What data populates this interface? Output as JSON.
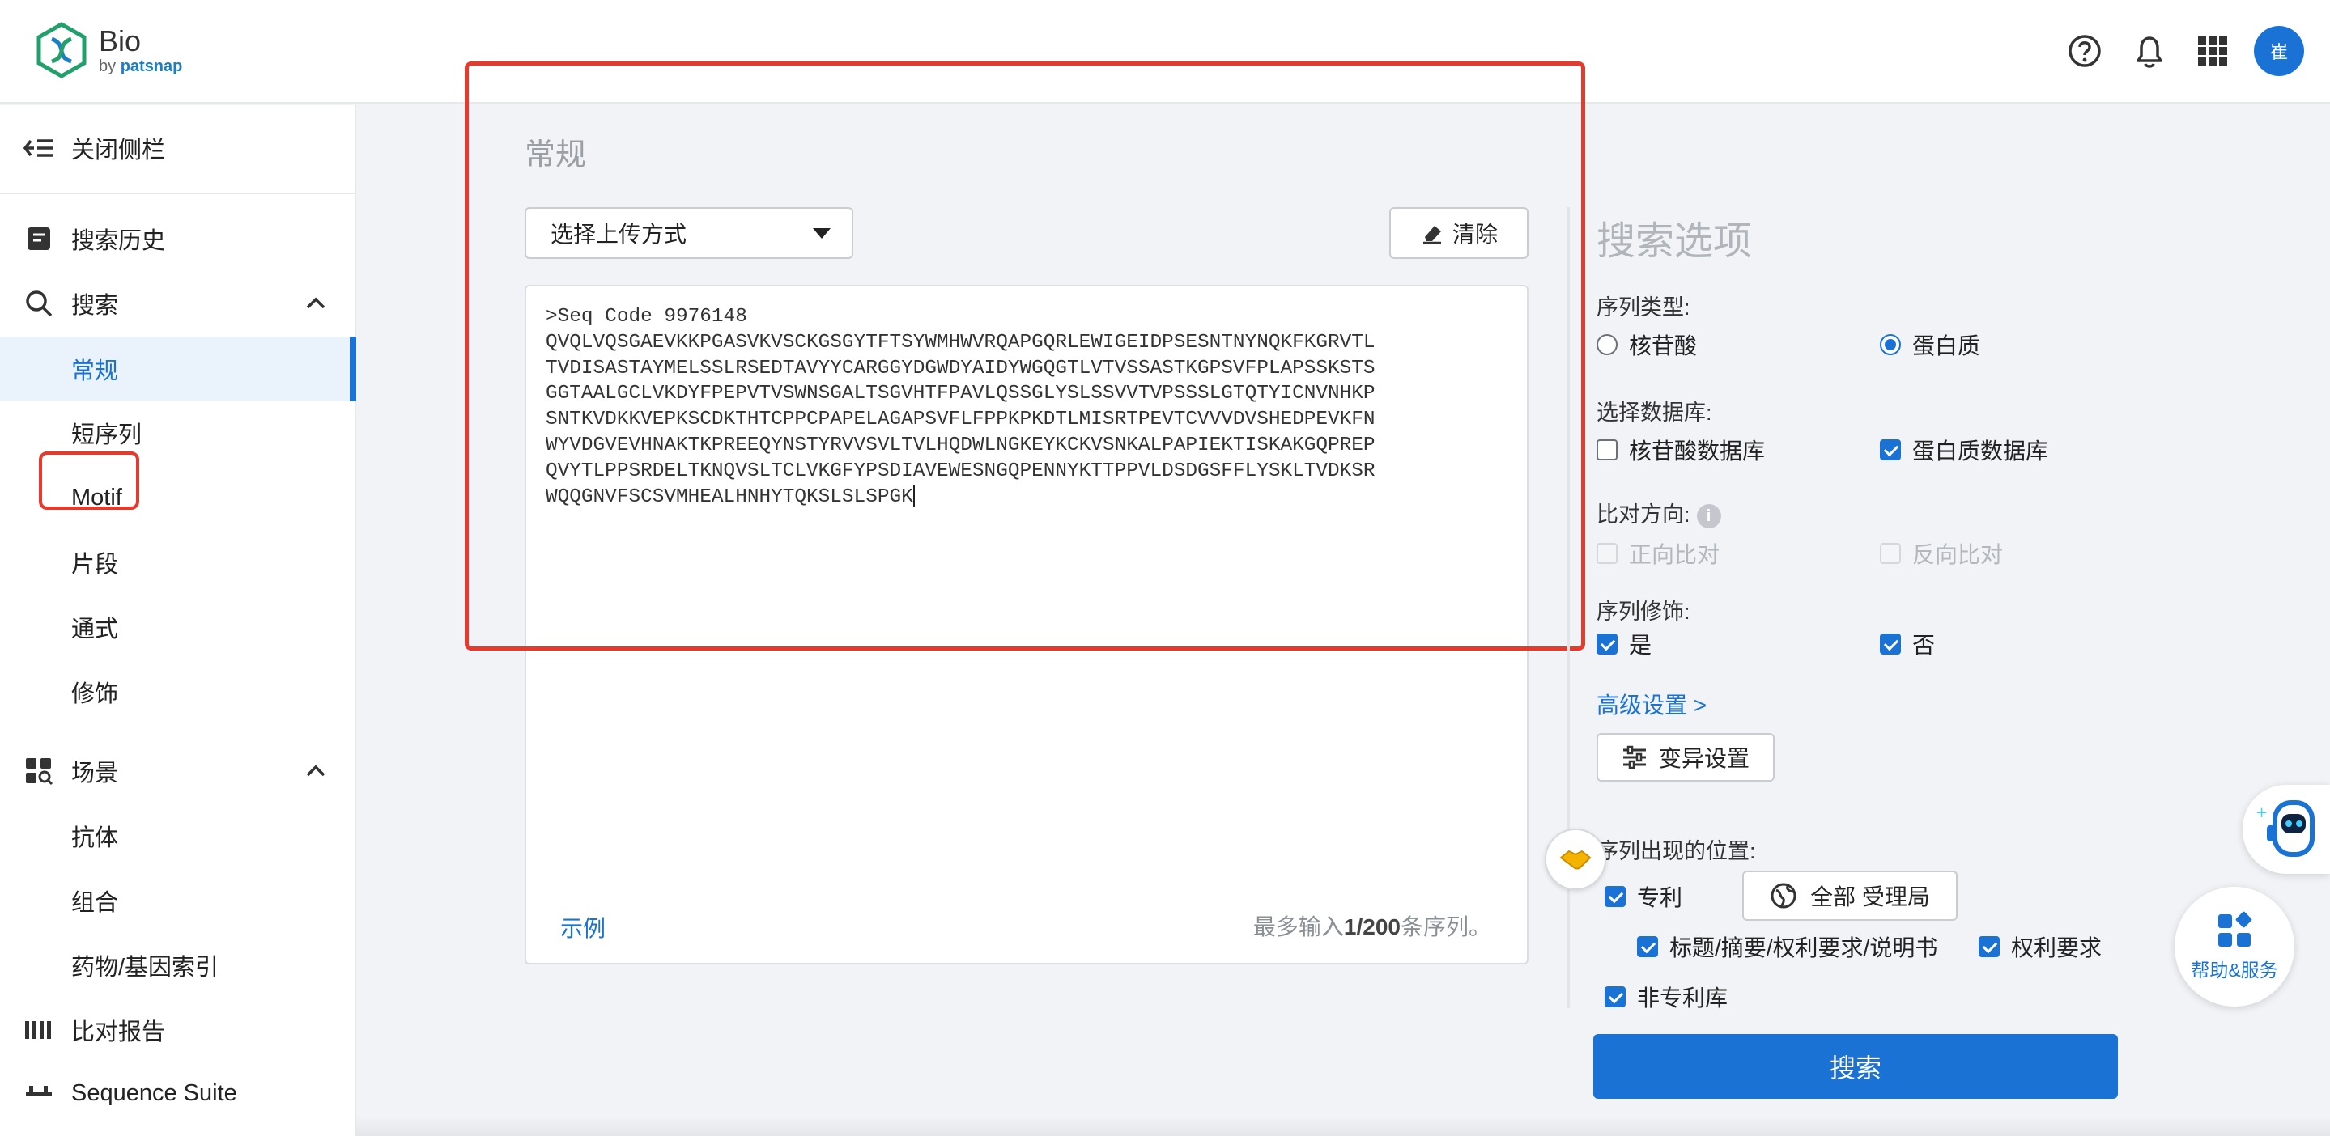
{
  "header": {
    "logo_name": "Bio",
    "logo_by": "by",
    "logo_brand": "patsnap",
    "icons": [
      "help-circle-icon",
      "bell-icon",
      "apps-grid-icon"
    ],
    "avatar_initial": "崔"
  },
  "sidebar": {
    "close_label": "关闭侧栏",
    "items": [
      {
        "label": "搜索历史",
        "icon": "history-icon"
      },
      {
        "label": "搜索",
        "icon": "search-icon",
        "expanded": true
      },
      {
        "label": "常规",
        "active": true
      },
      {
        "label": "短序列"
      },
      {
        "label": "Motif"
      },
      {
        "label": "片段"
      },
      {
        "label": "通式"
      },
      {
        "label": "修饰"
      },
      {
        "label": "场景",
        "icon": "scenario-icon",
        "expanded": true
      },
      {
        "label": "抗体"
      },
      {
        "label": "组合"
      },
      {
        "label": "药物/基因索引"
      },
      {
        "label": "比对报告",
        "icon": "report-icon"
      },
      {
        "label": "Sequence Suite",
        "icon": "suite-icon"
      }
    ]
  },
  "main": {
    "section_title": "常规",
    "upload_select": "选择上传方式",
    "clear_button": "清除",
    "sequence_text": ">Seq Code 9976148\nQVQLVQSGAEVKKPGASVKVSCKGSGYTFTSYWMHWVRQAPGQRLEWIGEIDPSESNTNYNQKFKGRVTL\nTVDISASTAYMELSSLRSEDTAVYYCARGGYDGWDYAIDYWGQGTLVTVSSASTKGPSVFPLAPSSKSTS\nGGTAALGCLVKDYFPEPVTVSWNSGALTSGVHTFPAVLQSSGLYSLSSVVTVPSSSLGTQTYICNVNHKP\nSNTKVDKKVEPKSCDKTHTCPPCPAPELAGAPSVFLFPPKPKDTLMISRTPEVTCVVVDVSHEDPEVKFN\nWYVDGVEVHNAKTKPREEQYNSTYRVVSVLTVLHQDWLNGKEYKCKVSNKALPAPIEKTISKAKGQPREP\nQVYTLPPSRDELTKNQVSLTCLVKGFYPSDIAVEWESNGQPENNYKTTPPVLDSDGSFFLYSKLTVDKSR\nWQQGNVFSCSVMHEALHNHYTQKSLSLSPGK",
    "example_link": "示例",
    "limit_prefix": "最多输入",
    "limit_count": "1/200",
    "limit_suffix": "条序列。"
  },
  "options": {
    "title": "搜索选项",
    "seq_type_label": "序列类型:",
    "nucleotide": "核苷酸",
    "protein": "蛋白质",
    "seq_type_selected": "蛋白质",
    "db_label": "选择数据库:",
    "nucleotide_db": "核苷酸数据库",
    "protein_db": "蛋白质数据库",
    "direction_label": "比对方向:",
    "forward": "正向比对",
    "reverse": "反向比对",
    "modification_label": "序列修饰:",
    "mod_yes": "是",
    "mod_no": "否",
    "advanced_link": "高级设置 >",
    "variation_button": "变异设置",
    "location_label": "序列出现的位置:",
    "patent": "专利",
    "office_button": "全部 受理局",
    "title_abstract": "标题/摘要/权利要求/说明书",
    "claims": "权利要求",
    "non_patent": "非专利库",
    "search_button": "搜索"
  },
  "help_widget": "帮助&服务",
  "colors": {
    "accent": "#1a73d4",
    "highlight": "#e53a2c"
  }
}
